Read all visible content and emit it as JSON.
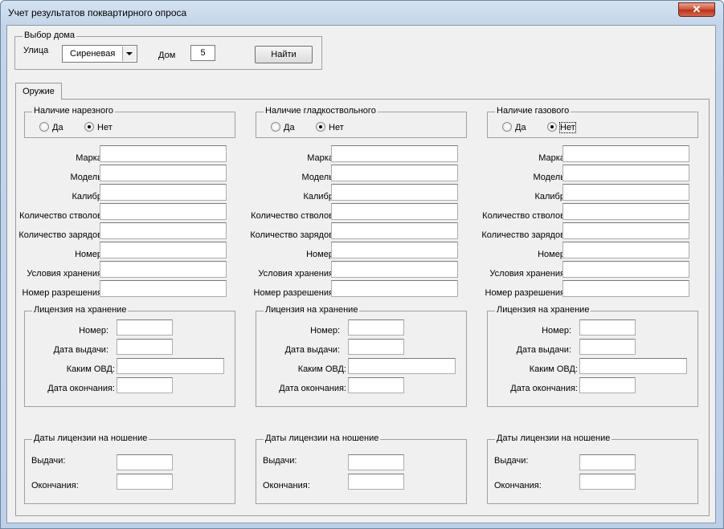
{
  "window": {
    "title": "Учет результатов поквартирного опроса",
    "close_glyph": "✕"
  },
  "house_select": {
    "legend": "Выбор дома",
    "street_label": "Улица",
    "street_value": "Сиреневая",
    "house_label": "Дом",
    "house_value": "5",
    "find_button": "Найти"
  },
  "tabs": [
    {
      "label": "Оружие",
      "selected": true
    }
  ],
  "columns": [
    {
      "presence_legend": "Наличие нарезного",
      "radio_yes": "Да",
      "radio_no": "Нет",
      "selected": "no",
      "fields": [
        "Марка:",
        "Модель:",
        "Калибр:",
        "Количество стволов:",
        "Количество зарядов:",
        "Номер:",
        "Условия хранения:",
        "Номер разрешения:"
      ],
      "storage_license": {
        "legend": "Лицензия на хранение",
        "number": "Номер:",
        "issue_date": "Дата выдачи:",
        "issuer": "Каким ОВД:",
        "end_date": "Дата окончания:"
      },
      "carry_license": {
        "legend": "Даты лицензии на ношение",
        "issue": "Выдачи:",
        "end": "Окончания:"
      }
    },
    {
      "presence_legend": "Наличие гладкоствольного",
      "radio_yes": "Да",
      "radio_no": "Нет",
      "selected": "no",
      "fields": [
        "Марка:",
        "Модель:",
        "Калибр:",
        "Количество стволов:",
        "Количество зарядов:",
        "Номер:",
        "Условия хранения:",
        "Номер разрешения:"
      ],
      "storage_license": {
        "legend": "Лицензия на хранение",
        "number": "Номер:",
        "issue_date": "Дата выдачи:",
        "issuer": "Каким ОВД:",
        "end_date": "Дата окончания:"
      },
      "carry_license": {
        "legend": "Даты лицензии на ношение",
        "issue": "Выдачи:",
        "end": "Окончания:"
      }
    },
    {
      "presence_legend": "Наличие газового",
      "radio_yes": "Да",
      "radio_no": "Нет",
      "selected": "no",
      "fields": [
        "Марка:",
        "Модель:",
        "Калибр:",
        "Количество стволов:",
        "Количество зарядов:",
        "Номер:",
        "Условия хранения:",
        "Номер разрешения:"
      ],
      "storage_license": {
        "legend": "Лицензия на хранение",
        "number": "Номер:",
        "issue_date": "Дата выдачи:",
        "issuer": "Каким ОВД:",
        "end_date": "Дата окончания:"
      },
      "carry_license": {
        "legend": "Даты лицензии на ношение",
        "issue": "Выдачи:",
        "end": "Окончания:"
      }
    }
  ]
}
